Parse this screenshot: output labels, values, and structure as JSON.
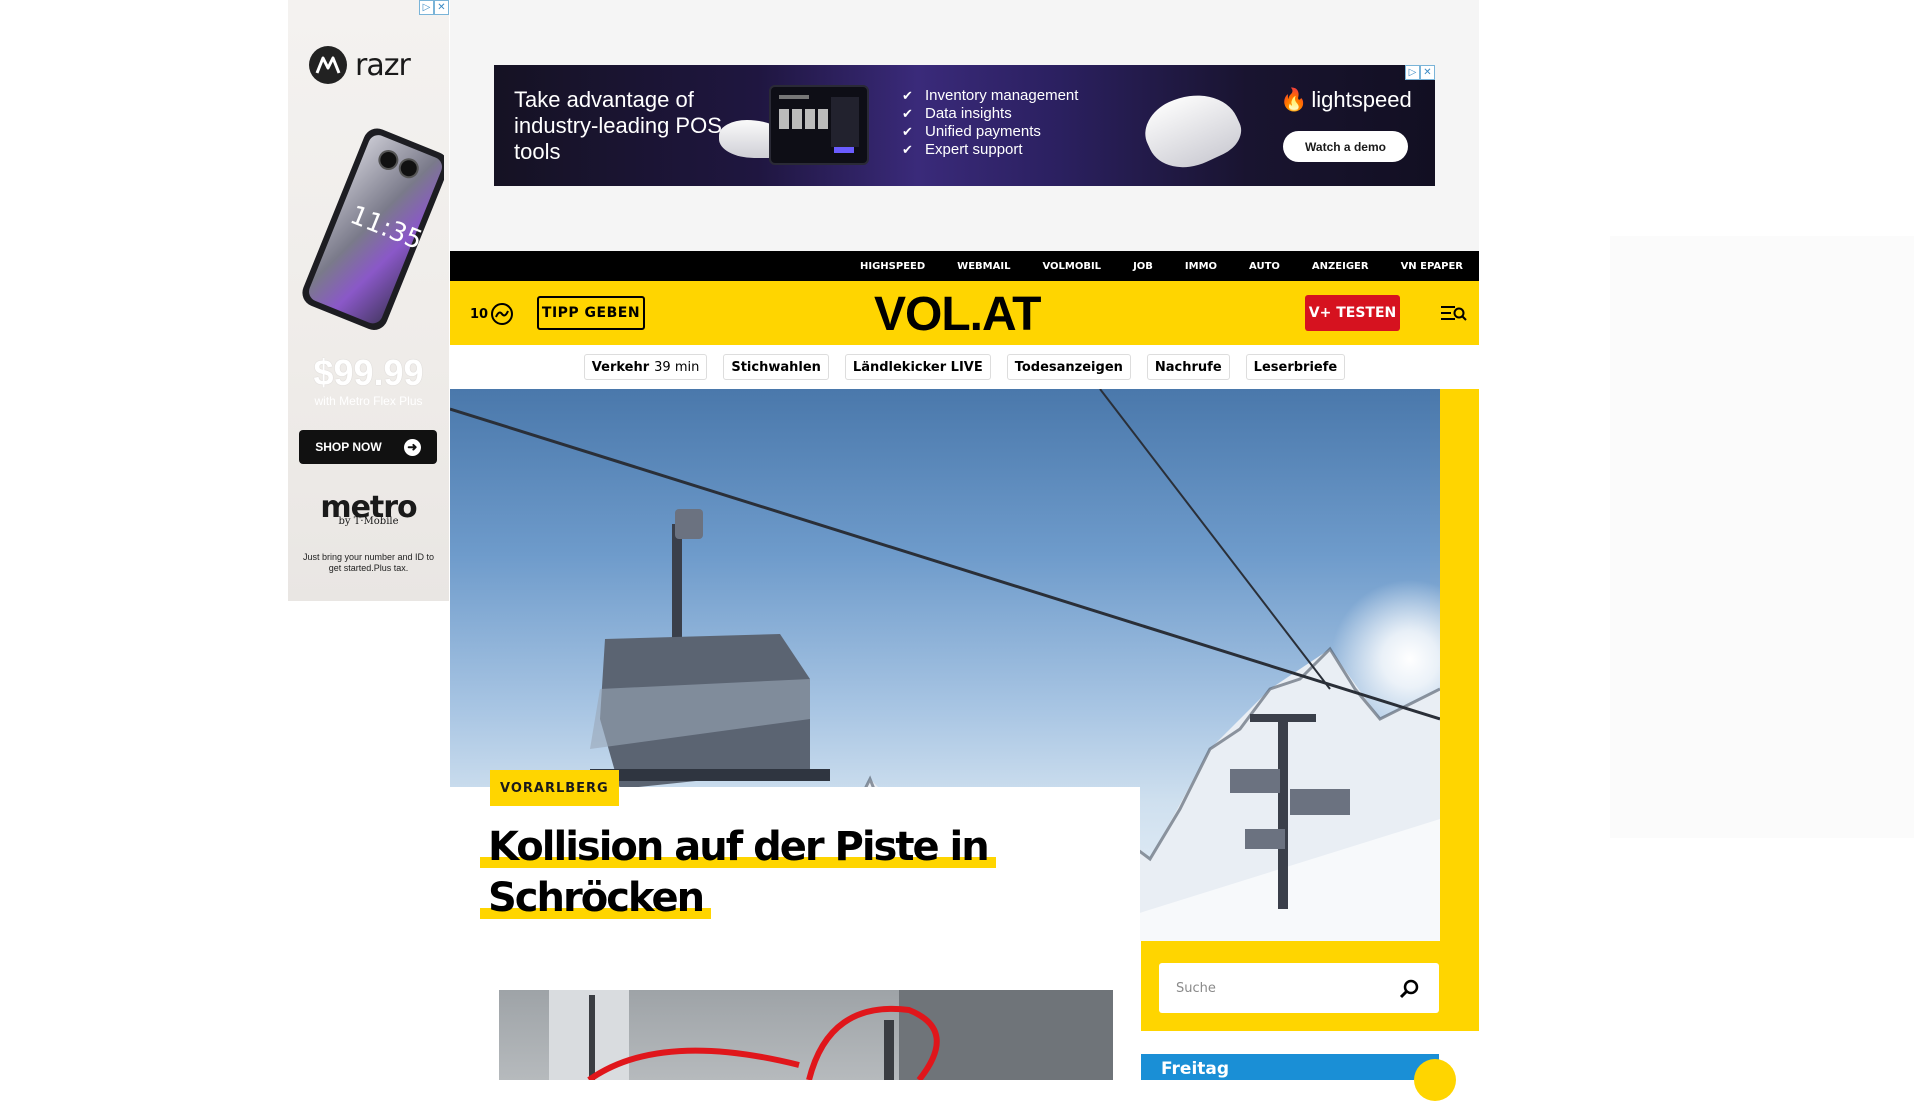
{
  "left_ad": {
    "adchoice_icons": [
      "▷",
      "✕"
    ],
    "brand": "razr",
    "price": "$99.99",
    "price_sub": "with Metro Flex Plus",
    "cta": "SHOP NOW",
    "carrier": "metro",
    "carrier_sub": "by T·Mobile",
    "fine_print": "Just bring your number and ID to get started.Plus tax.",
    "phone_time": "11:35"
  },
  "top_banner": {
    "headline": "Take advantage of industry-leading POS tools",
    "features": [
      "Inventory management",
      "Data insights",
      "Unified payments",
      "Expert support"
    ],
    "brand": "lightspeed",
    "cta": "Watch a demo",
    "adchoice_icons": [
      "▷",
      "✕"
    ]
  },
  "service_nav": [
    "HIGHSPEED",
    "WEBMAIL",
    "VOLMOBIL",
    "JOB",
    "IMMO",
    "AUTO",
    "ANZEIGER",
    "VN EPAPER"
  ],
  "header": {
    "temperature": "10",
    "tipp_label": "TIPP GEBEN",
    "logo": "VOL.AT",
    "testen_label": "V+ TESTEN"
  },
  "quick_links": [
    {
      "label": "Verkehr",
      "extra": "39 min"
    },
    {
      "label": "Stichwahlen",
      "extra": ""
    },
    {
      "label": "Ländlekicker LIVE",
      "extra": ""
    },
    {
      "label": "Todesanzeigen",
      "extra": ""
    },
    {
      "label": "Nachrufe",
      "extra": ""
    },
    {
      "label": "Leserbriefe",
      "extra": ""
    }
  ],
  "article": {
    "category": "VORARLBERG",
    "title_line1": "Kollision auf der Piste in",
    "title_line2": "Schröcken"
  },
  "sidebar": {
    "search_placeholder": "Suche",
    "day_label": "Freitag"
  },
  "colors": {
    "brand_yellow": "#ffd500",
    "testen_red": "#d6121f",
    "nav_black": "#000000",
    "weather_blue": "#1a8fd6"
  },
  "icons": {
    "weather": "cloud-icon",
    "menu": "menu-search-icon",
    "search": "search-icon"
  }
}
